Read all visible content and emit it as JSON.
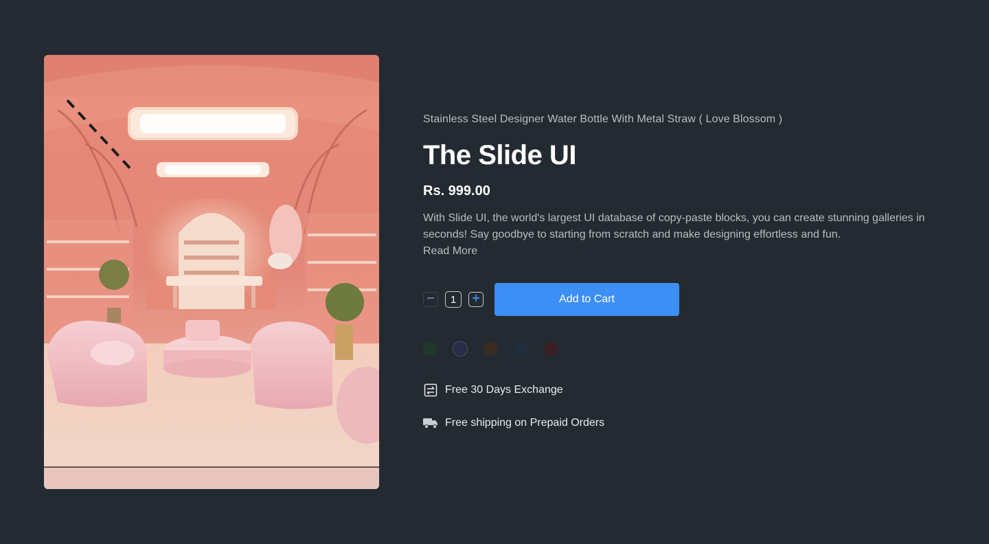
{
  "product": {
    "subtitle": "Stainless Steel Designer Water Bottle With Metal Straw ( Love Blossom )",
    "title": "The Slide UI",
    "price": "Rs. 999.00",
    "description": "With Slide UI, the world's largest UI database of copy-paste blocks, you can create stunning galleries in seconds! Say goodbye to starting from scratch and make designing effortless and fun.",
    "read_more": "Read More",
    "quantity": "1",
    "add_to_cart_label": "Add to Cart"
  },
  "swatches": [
    {
      "color": "#1f3a2a",
      "selected": false
    },
    {
      "color": "#2a2d4a",
      "selected": true
    },
    {
      "color": "#3b2c20",
      "selected": false
    },
    {
      "color": "#1f2e3d",
      "selected": false
    },
    {
      "color": "#3a1f22",
      "selected": false
    }
  ],
  "features": {
    "exchange": "Free 30 Days Exchange",
    "shipping": "Free shipping on Prepaid Orders"
  },
  "icons": {
    "minus": "minus-icon",
    "plus": "plus-icon",
    "exchange": "exchange-icon",
    "truck": "truck-icon"
  },
  "colors": {
    "background": "#242a31",
    "accent": "#3d8ff5",
    "muted_text": "#b9bec5"
  }
}
